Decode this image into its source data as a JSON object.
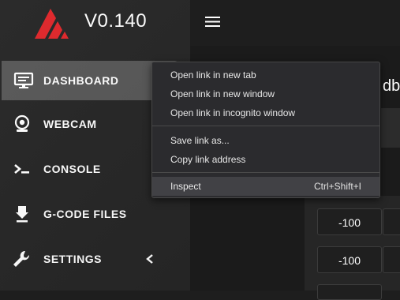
{
  "app": {
    "version": "V0.140",
    "brand_color": "#e0272b"
  },
  "sidebar": {
    "items": [
      {
        "label": "DASHBOARD",
        "icon": "monitor-icon",
        "active": true
      },
      {
        "label": "WEBCAM",
        "icon": "webcam-icon"
      },
      {
        "label": "CONSOLE",
        "icon": "terminal-icon"
      },
      {
        "label": "G-CODE FILES",
        "icon": "file-upload-icon"
      },
      {
        "label": "SETTINGS",
        "icon": "wrench-icon",
        "expand_icon": "chevron-left-icon"
      }
    ]
  },
  "header": {
    "menu_icon": "hamburger-icon"
  },
  "main": {
    "card_title_partial": "dby",
    "jog_buttons": [
      "-100",
      "-100"
    ]
  },
  "context_menu": {
    "items": [
      {
        "label": "Open link in new tab"
      },
      {
        "label": "Open link in new window"
      },
      {
        "label": "Open link in incognito window"
      },
      {
        "label": "Save link as..."
      },
      {
        "label": "Copy link address"
      },
      {
        "label": "Inspect",
        "shortcut": "Ctrl+Shift+I",
        "highlighted": true
      }
    ]
  }
}
